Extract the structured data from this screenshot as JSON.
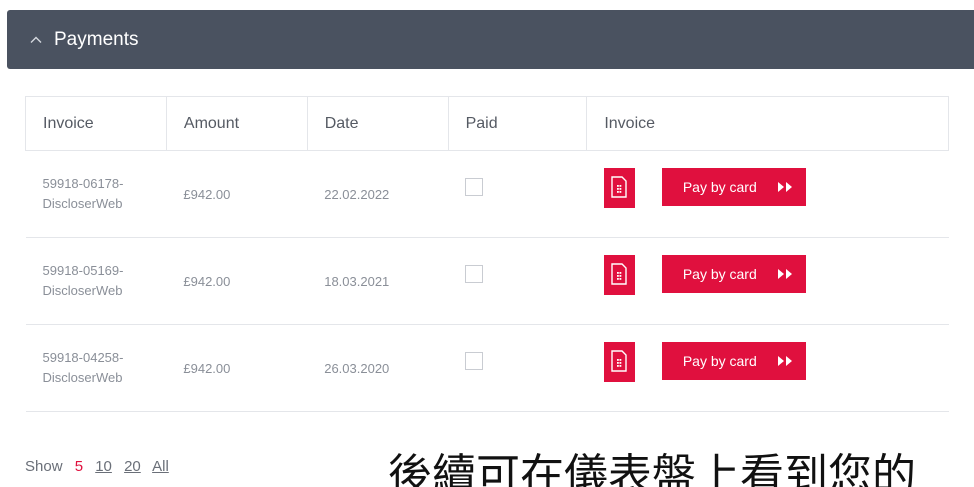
{
  "panel": {
    "title": "Payments",
    "icon": "chevron-up-icon"
  },
  "table": {
    "headers": [
      "Invoice",
      "Amount",
      "Date",
      "Paid",
      "Invoice"
    ],
    "rows": [
      {
        "invoice_line1": "59918-06178-",
        "invoice_line2": "DiscloserWeb",
        "amount": "£942.00",
        "date": "22.02.2022",
        "paid": false,
        "pay_label": "Pay by card"
      },
      {
        "invoice_line1": "59918-05169-",
        "invoice_line2": "DiscloserWeb",
        "amount": "£942.00",
        "date": "18.03.2021",
        "paid": false,
        "pay_label": "Pay by card"
      },
      {
        "invoice_line1": "59918-04258-",
        "invoice_line2": "DiscloserWeb",
        "amount": "£942.00",
        "date": "26.03.2020",
        "paid": false,
        "pay_label": "Pay by card"
      }
    ]
  },
  "pager": {
    "label": "Show",
    "options": [
      "5",
      "10",
      "20",
      "All"
    ],
    "selected": "5"
  },
  "overlay": {
    "text": "後續可在儀表盤上看到您的"
  },
  "colors": {
    "header_bg": "#4a5260",
    "accent": "#e0103e"
  }
}
